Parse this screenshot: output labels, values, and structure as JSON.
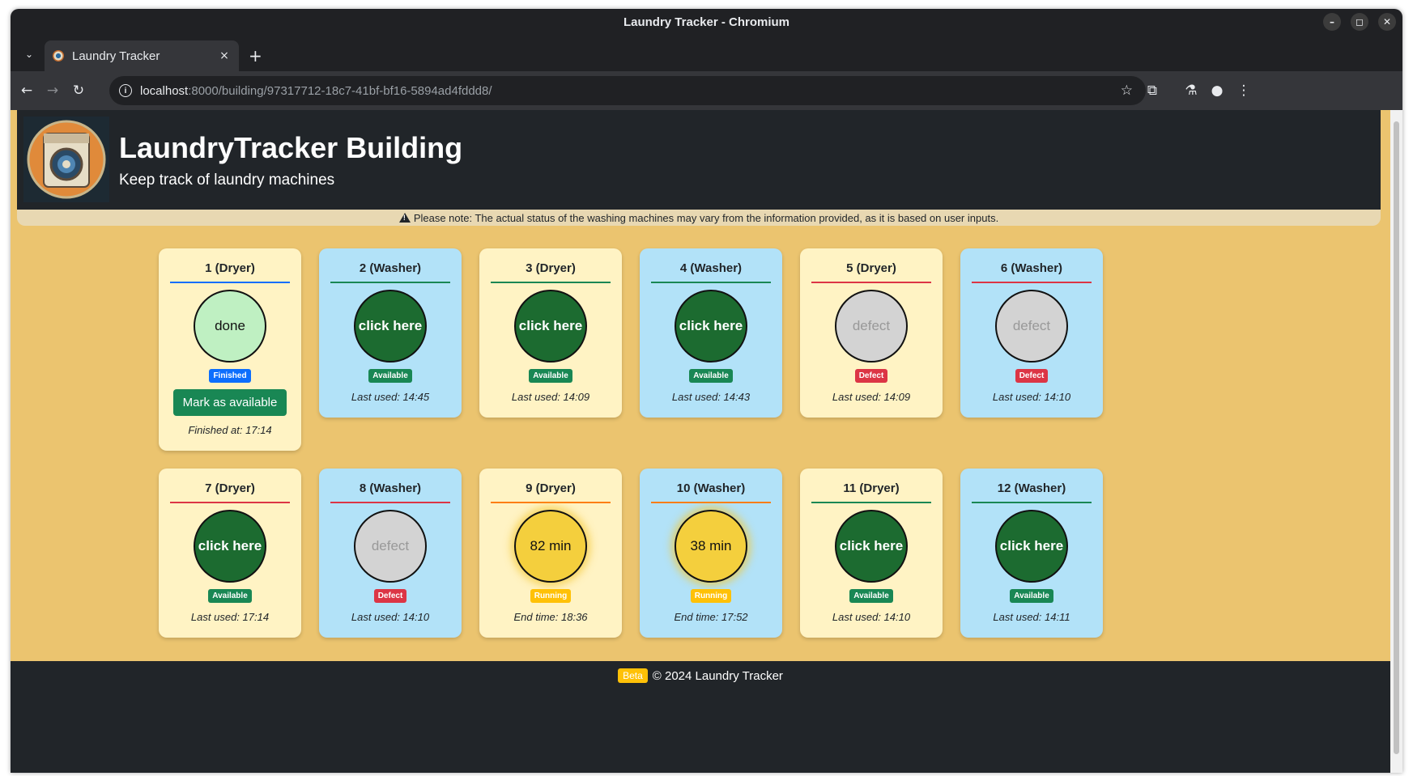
{
  "window": {
    "title": "Laundry Tracker - Chromium",
    "controls": [
      "–",
      "◻",
      "✕"
    ]
  },
  "browser": {
    "tab_title": "Laundry Tracker",
    "tab_close": "×",
    "new_tab": "+",
    "url_host": "localhost",
    "url_path": ":8000/building/97317712-18c7-41bf-bf16-5894ad4fddd8/"
  },
  "header": {
    "title": "LaundryTracker Building",
    "subtitle": "Keep track of laundry machines"
  },
  "notice": "Please note: The actual status of the washing machines may vary from the information provided, as it is based on user inputs.",
  "machines": [
    {
      "title": "1 (Dryer)",
      "kind": "dryer",
      "state": "finished",
      "circle_text": "done",
      "badge": "Finished",
      "button": "Mark as available",
      "info": "Finished at: 17:14",
      "line_color": "#0d6efd"
    },
    {
      "title": "2 (Washer)",
      "kind": "washer",
      "state": "available",
      "circle_text": "click here",
      "badge": "Available",
      "info": "Last used: 14:45",
      "line_color": "#198754"
    },
    {
      "title": "3 (Dryer)",
      "kind": "dryer",
      "state": "available",
      "circle_text": "click here",
      "badge": "Available",
      "info": "Last used: 14:09",
      "line_color": "#198754"
    },
    {
      "title": "4 (Washer)",
      "kind": "washer",
      "state": "available",
      "circle_text": "click here",
      "badge": "Available",
      "info": "Last used: 14:43",
      "line_color": "#198754"
    },
    {
      "title": "5 (Dryer)",
      "kind": "dryer",
      "state": "defect",
      "circle_text": "defect",
      "badge": "Defect",
      "info": "Last used: 14:09",
      "line_color": "#dc3545"
    },
    {
      "title": "6 (Washer)",
      "kind": "washer",
      "state": "defect",
      "circle_text": "defect",
      "badge": "Defect",
      "info": "Last used: 14:10",
      "line_color": "#dc3545"
    },
    {
      "title": "7 (Dryer)",
      "kind": "dryer",
      "state": "available",
      "circle_text": "click here",
      "badge": "Available",
      "info": "Last used: 17:14",
      "line_color": "#dc3545"
    },
    {
      "title": "8 (Washer)",
      "kind": "washer",
      "state": "defect",
      "circle_text": "defect",
      "badge": "Defect",
      "info": "Last used: 14:10",
      "line_color": "#dc3545"
    },
    {
      "title": "9 (Dryer)",
      "kind": "dryer",
      "state": "running",
      "circle_text": "82 min",
      "badge": "Running",
      "info": "End time: 18:36",
      "line_color": "#fd7e14"
    },
    {
      "title": "10 (Washer)",
      "kind": "washer",
      "state": "running",
      "circle_text": "38 min",
      "badge": "Running",
      "info": "End time: 17:52",
      "line_color": "#fd7e14"
    },
    {
      "title": "11 (Dryer)",
      "kind": "dryer",
      "state": "available",
      "circle_text": "click here",
      "badge": "Available",
      "info": "Last used: 14:10",
      "line_color": "#198754"
    },
    {
      "title": "12 (Washer)",
      "kind": "washer",
      "state": "available",
      "circle_text": "click here",
      "badge": "Available",
      "info": "Last used: 14:11",
      "line_color": "#198754"
    }
  ],
  "footer": {
    "beta": "Beta",
    "text": "© 2024 Laundry Tracker"
  },
  "colors": {
    "page_bg": "#ebc46f",
    "header_bg": "#212529",
    "dryer_card": "#fff3c4",
    "washer_card": "#b2e2f8",
    "available": "#1c6b30",
    "running": "#f4cf3d"
  }
}
